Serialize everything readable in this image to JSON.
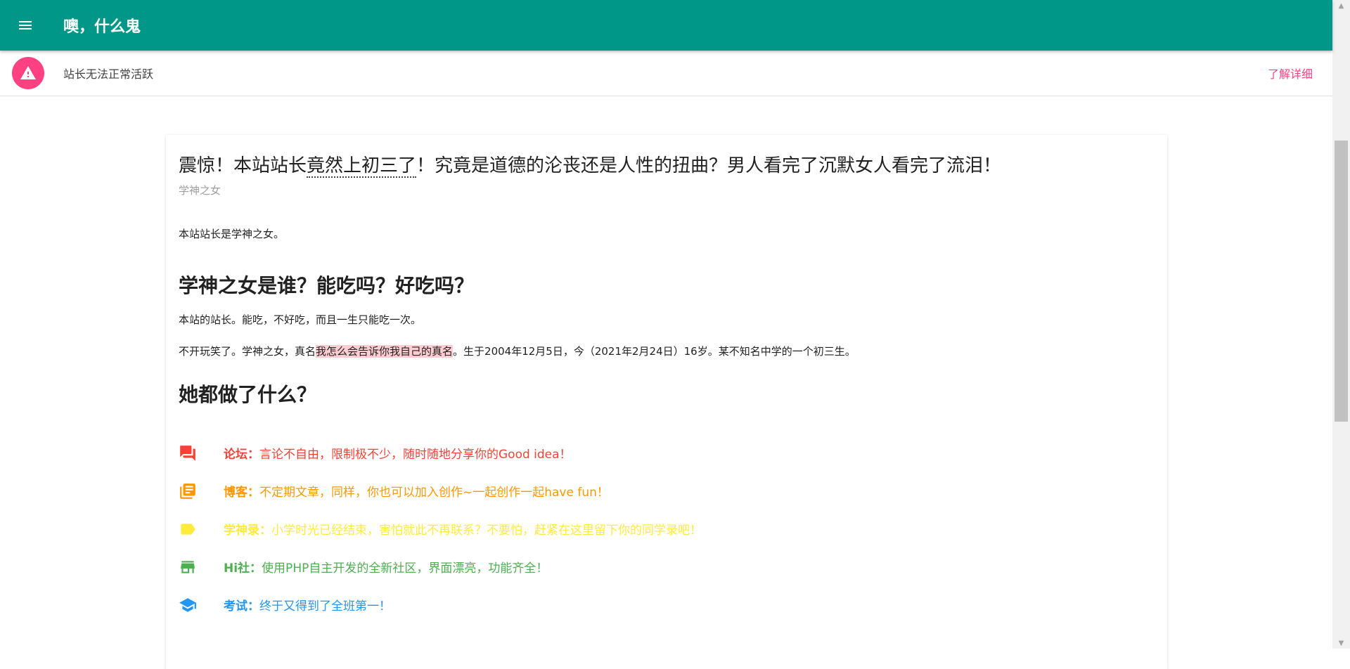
{
  "appbar": {
    "title": "噢，什么鬼",
    "menu_icon": "menu-icon"
  },
  "notice": {
    "icon": "warning-icon",
    "text": "站长无法正常活跃",
    "action": "了解详细"
  },
  "article": {
    "title_parts": [
      "震惊！本站站长",
      "竟然上初三了",
      "！究竟是道德的沦丧还是人性的扭曲？男人看完了沉默女人看完了流泪！"
    ],
    "author": "学神之女",
    "intro": "本站站长是学神之女。",
    "h1": "学神之女是谁？能吃吗？好吃吗？",
    "p1": "本站的站长。能吃，不好吃，而且一生只能吃一次。",
    "p2_parts": [
      "不开玩笑了。学神之女，真名",
      "我怎么会告诉你我自己的真名",
      "。生于2004年12月5日，今（2021年2月24日）16岁。某不知名中学的一个初三生。"
    ],
    "h2": "她都做了什么？"
  },
  "features": [
    {
      "icon": "forum-icon",
      "label": "论坛：",
      "desc": "言论不自由，限制极不少，随时随地分享你的Good idea！",
      "color": "#f44336"
    },
    {
      "icon": "library-books-icon",
      "label": "博客：",
      "desc": "不定期文章，同样，你也可以加入创作~一起创作一起have fun！",
      "color": "#ff9800"
    },
    {
      "icon": "label-icon",
      "label": "学神录：",
      "desc": "小学时光已经结束，害怕就此不再联系？不要怕，赶紧在这里留下你的同学录吧！",
      "color": "#ffeb3b"
    },
    {
      "icon": "store-icon",
      "label": "Hi社：",
      "desc": "使用PHP自主开发的全新社区，界面漂亮，功能齐全！",
      "color": "#4caf50"
    },
    {
      "icon": "school-icon",
      "label": "考试：",
      "desc": "终于又得到了全班第一！",
      "color": "#2196f3"
    }
  ]
}
